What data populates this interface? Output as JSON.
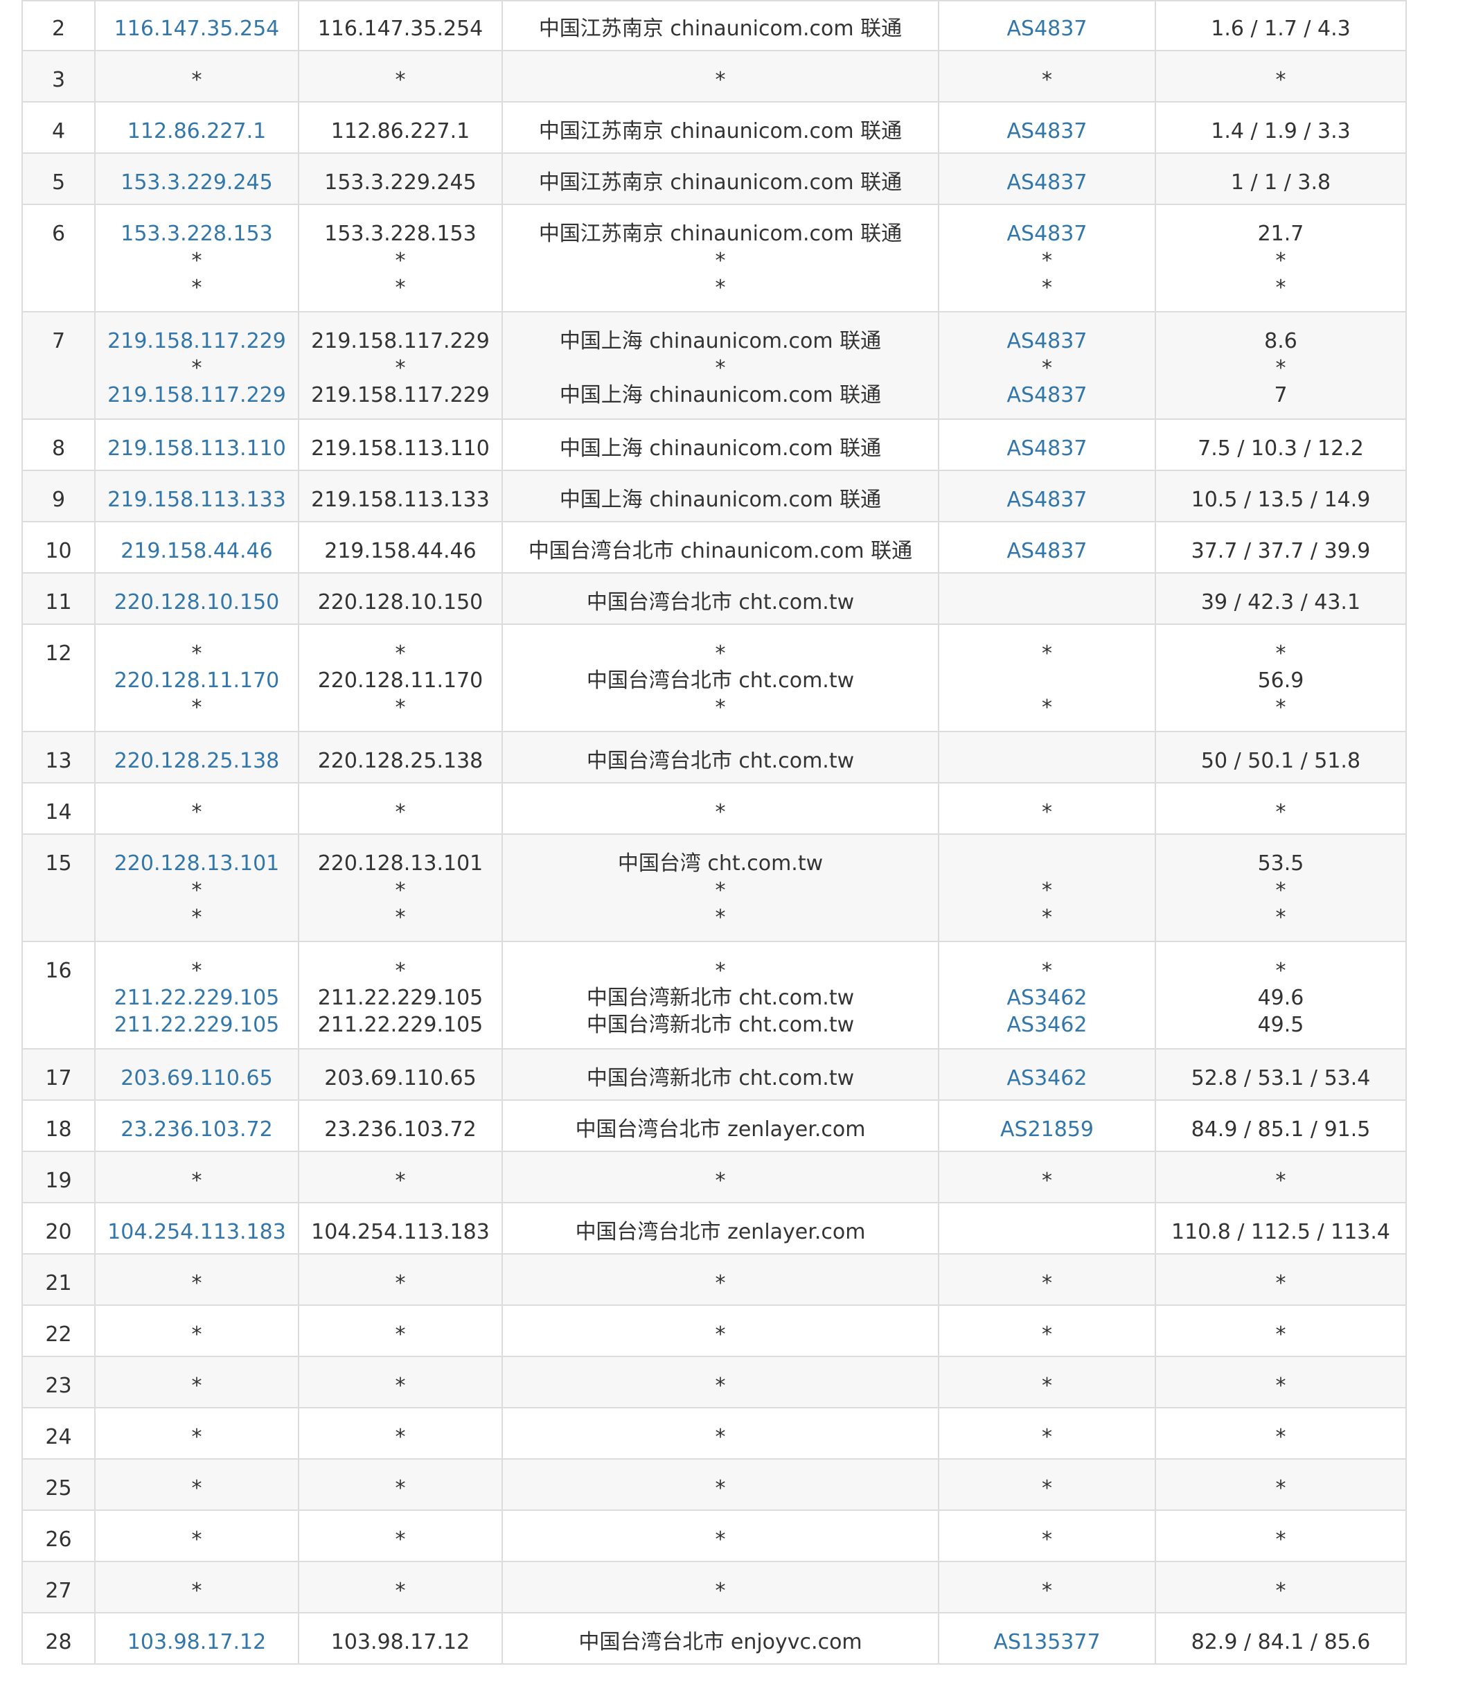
{
  "colors": {
    "link": "#3377aa",
    "text": "#333333",
    "border": "#dcdcdc",
    "alt_row": "#f7f7f7"
  },
  "rows": [
    {
      "hop": "2",
      "h": 72,
      "lines": [
        {
          "ip": "116.147.35.254",
          "host": "116.147.35.254",
          "loc": "中国江苏南京 chinaunicom.com 联通",
          "asn": "AS4837",
          "rtt": "1.6 / 1.7 / 4.3"
        }
      ]
    },
    {
      "hop": "3",
      "h": 74,
      "lines": [
        {
          "ip": "*",
          "host": "*",
          "loc": "*",
          "asn": "*",
          "rtt": "*"
        }
      ]
    },
    {
      "hop": "4",
      "h": 74,
      "lines": [
        {
          "ip": "112.86.227.1",
          "host": "112.86.227.1",
          "loc": "中国江苏南京 chinaunicom.com 联通",
          "asn": "AS4837",
          "rtt": "1.4 / 1.9 / 3.3"
        }
      ]
    },
    {
      "hop": "5",
      "h": 74,
      "lines": [
        {
          "ip": "153.3.229.245",
          "host": "153.3.229.245",
          "loc": "中国江苏南京 chinaunicom.com 联通",
          "asn": "AS4837",
          "rtt": "1 / 1 / 3.8"
        }
      ]
    },
    {
      "hop": "6",
      "h": 155,
      "lines": [
        {
          "ip": "153.3.228.153",
          "host": "153.3.228.153",
          "loc": "中国江苏南京 chinaunicom.com 联通",
          "asn": "AS4837",
          "rtt": "21.7"
        },
        {
          "ip": "*",
          "host": "*",
          "loc": "*",
          "asn": "*",
          "rtt": "*"
        },
        {
          "ip": "*",
          "host": "*",
          "loc": "*",
          "asn": "*",
          "rtt": "*"
        }
      ]
    },
    {
      "hop": "7",
      "h": 155,
      "lines": [
        {
          "ip": "219.158.117.229",
          "host": "219.158.117.229",
          "loc": "中国上海 chinaunicom.com 联通",
          "asn": "AS4837",
          "rtt": "8.6"
        },
        {
          "ip": "*",
          "host": "*",
          "loc": "*",
          "asn": "*",
          "rtt": "*"
        },
        {
          "ip": "219.158.117.229",
          "host": "219.158.117.229",
          "loc": "中国上海 chinaunicom.com 联通",
          "asn": "AS4837",
          "rtt": "7"
        }
      ]
    },
    {
      "hop": "8",
      "h": 74,
      "lines": [
        {
          "ip": "219.158.113.110",
          "host": "219.158.113.110",
          "loc": "中国上海 chinaunicom.com 联通",
          "asn": "AS4837",
          "rtt": "7.5 / 10.3 / 12.2"
        }
      ]
    },
    {
      "hop": "9",
      "h": 74,
      "lines": [
        {
          "ip": "219.158.113.133",
          "host": "219.158.113.133",
          "loc": "中国上海 chinaunicom.com 联通",
          "asn": "AS4837",
          "rtt": "10.5 / 13.5 / 14.9"
        }
      ]
    },
    {
      "hop": "10",
      "h": 74,
      "lines": [
        {
          "ip": "219.158.44.46",
          "host": "219.158.44.46",
          "loc": "中国台湾台北市 chinaunicom.com 联通",
          "asn": "AS4837",
          "rtt": "37.7 / 37.7 / 39.9"
        }
      ]
    },
    {
      "hop": "11",
      "h": 74,
      "lines": [
        {
          "ip": "220.128.10.150",
          "host": "220.128.10.150",
          "loc": "中国台湾台北市 cht.com.tw",
          "asn": "",
          "rtt": "39 / 42.3 / 43.1"
        }
      ]
    },
    {
      "hop": "12",
      "h": 155,
      "lines": [
        {
          "ip": "*",
          "host": "*",
          "loc": "*",
          "asn": "*",
          "rtt": "*"
        },
        {
          "ip": "220.128.11.170",
          "host": "220.128.11.170",
          "loc": "中国台湾台北市 cht.com.tw",
          "asn": "",
          "rtt": "56.9"
        },
        {
          "ip": "*",
          "host": "*",
          "loc": "*",
          "asn": "*",
          "rtt": "*"
        }
      ]
    },
    {
      "hop": "13",
      "h": 74,
      "lines": [
        {
          "ip": "220.128.25.138",
          "host": "220.128.25.138",
          "loc": "中国台湾台北市 cht.com.tw",
          "asn": "",
          "rtt": "50 / 50.1 / 51.8"
        }
      ]
    },
    {
      "hop": "14",
      "h": 74,
      "lines": [
        {
          "ip": "*",
          "host": "*",
          "loc": "*",
          "asn": "*",
          "rtt": "*"
        }
      ]
    },
    {
      "hop": "15",
      "h": 155,
      "lines": [
        {
          "ip": "220.128.13.101",
          "host": "220.128.13.101",
          "loc": "中国台湾 cht.com.tw",
          "asn": "",
          "rtt": "53.5"
        },
        {
          "ip": "*",
          "host": "*",
          "loc": "*",
          "asn": "*",
          "rtt": "*"
        },
        {
          "ip": "*",
          "host": "*",
          "loc": "*",
          "asn": "*",
          "rtt": "*"
        }
      ]
    },
    {
      "hop": "16",
      "h": 155,
      "lines": [
        {
          "ip": "*",
          "host": "*",
          "loc": "*",
          "asn": "*",
          "rtt": "*"
        },
        {
          "ip": "211.22.229.105",
          "host": "211.22.229.105",
          "loc": "中国台湾新北市 cht.com.tw",
          "asn": "AS3462",
          "rtt": "49.6"
        },
        {
          "ip": "211.22.229.105",
          "host": "211.22.229.105",
          "loc": "中国台湾新北市 cht.com.tw",
          "asn": "AS3462",
          "rtt": "49.5"
        }
      ]
    },
    {
      "hop": "17",
      "h": 74,
      "lines": [
        {
          "ip": "203.69.110.65",
          "host": "203.69.110.65",
          "loc": "中国台湾新北市 cht.com.tw",
          "asn": "AS3462",
          "rtt": "52.8 / 53.1 / 53.4"
        }
      ]
    },
    {
      "hop": "18",
      "h": 74,
      "lines": [
        {
          "ip": "23.236.103.72",
          "host": "23.236.103.72",
          "loc": "中国台湾台北市 zenlayer.com",
          "asn": "AS21859",
          "rtt": "84.9 / 85.1 / 91.5"
        }
      ]
    },
    {
      "hop": "19",
      "h": 74,
      "lines": [
        {
          "ip": "*",
          "host": "*",
          "loc": "*",
          "asn": "*",
          "rtt": "*"
        }
      ]
    },
    {
      "hop": "20",
      "h": 74,
      "lines": [
        {
          "ip": "104.254.113.183",
          "host": "104.254.113.183",
          "loc": "中国台湾台北市 zenlayer.com",
          "asn": "",
          "rtt": "110.8 / 112.5 / 113.4"
        }
      ]
    },
    {
      "hop": "21",
      "h": 74,
      "lines": [
        {
          "ip": "*",
          "host": "*",
          "loc": "*",
          "asn": "*",
          "rtt": "*"
        }
      ]
    },
    {
      "hop": "22",
      "h": 74,
      "lines": [
        {
          "ip": "*",
          "host": "*",
          "loc": "*",
          "asn": "*",
          "rtt": "*"
        }
      ]
    },
    {
      "hop": "23",
      "h": 74,
      "lines": [
        {
          "ip": "*",
          "host": "*",
          "loc": "*",
          "asn": "*",
          "rtt": "*"
        }
      ]
    },
    {
      "hop": "24",
      "h": 74,
      "lines": [
        {
          "ip": "*",
          "host": "*",
          "loc": "*",
          "asn": "*",
          "rtt": "*"
        }
      ]
    },
    {
      "hop": "25",
      "h": 74,
      "lines": [
        {
          "ip": "*",
          "host": "*",
          "loc": "*",
          "asn": "*",
          "rtt": "*"
        }
      ]
    },
    {
      "hop": "26",
      "h": 74,
      "lines": [
        {
          "ip": "*",
          "host": "*",
          "loc": "*",
          "asn": "*",
          "rtt": "*"
        }
      ]
    },
    {
      "hop": "27",
      "h": 74,
      "lines": [
        {
          "ip": "*",
          "host": "*",
          "loc": "*",
          "asn": "*",
          "rtt": "*"
        }
      ]
    },
    {
      "hop": "28",
      "h": 74,
      "lines": [
        {
          "ip": "103.98.17.12",
          "host": "103.98.17.12",
          "loc": "中国台湾台北市 enjoyvc.com",
          "asn": "AS135377",
          "rtt": "82.9 / 84.1 / 85.6"
        }
      ]
    }
  ]
}
